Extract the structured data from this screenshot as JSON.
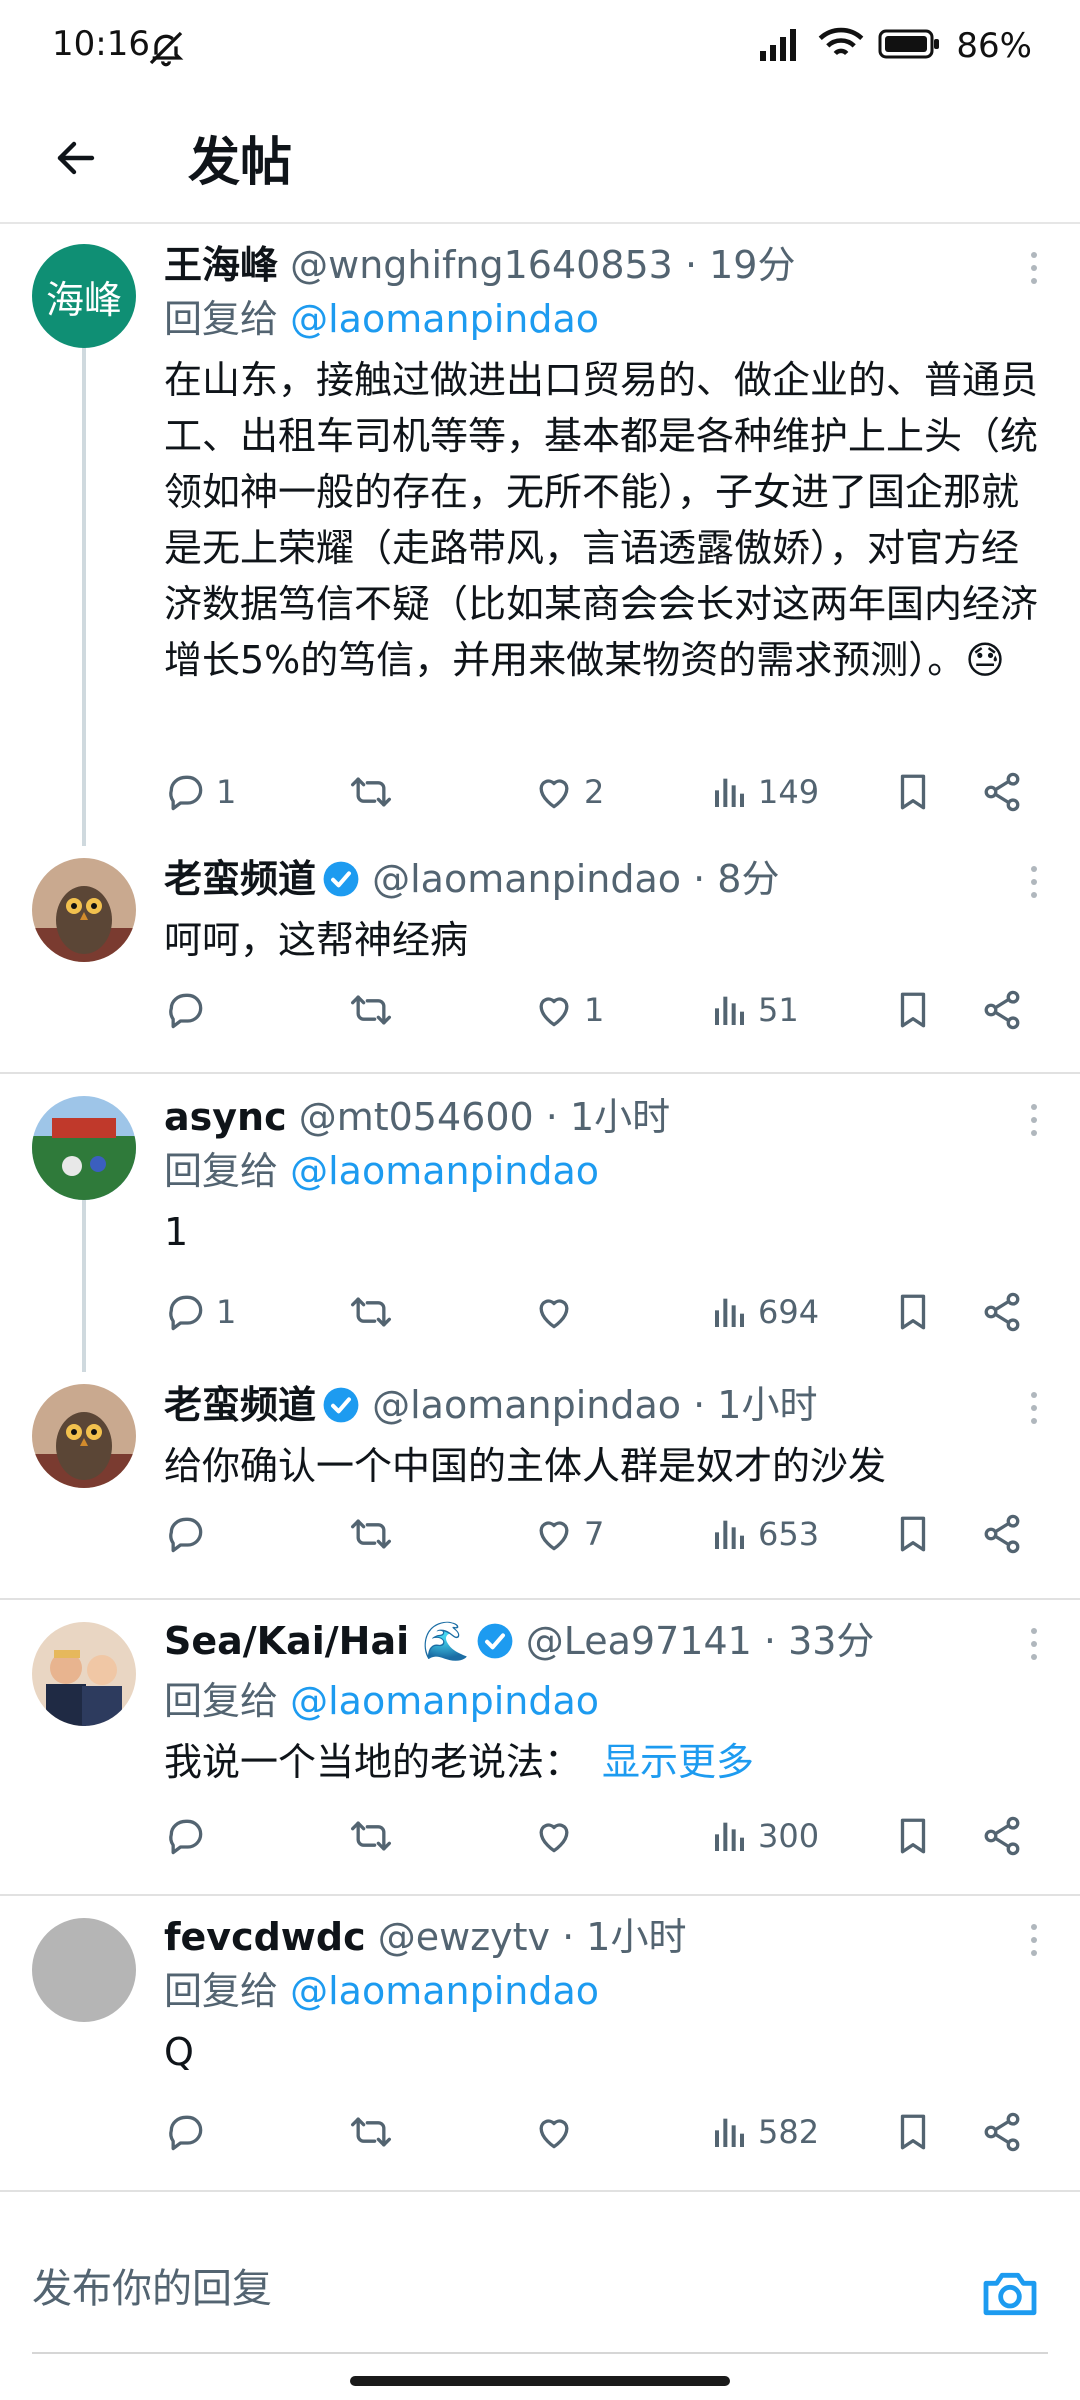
{
  "status": {
    "time": "10:16",
    "battery": "86%"
  },
  "header": {
    "title": "发帖"
  },
  "posts": [
    {
      "name": "王海峰",
      "handle": "@wnghifng1640853",
      "time": "· 19分",
      "reply_label": "回复给",
      "reply_to": "@laomanpindao",
      "avatar_text": "海峰",
      "text": "在山东，接触过做进出口贸易的、做企业的、普通员工、出租车司机等等，基本都是各种维护上上头（统领如神一般的存在，无所不能），子女进了国企那就是无上荣耀（走路带风，言语透露傲娇），对官方经济数据笃信不疑（比如某商会会长对这两年国内经济增长5%的笃信，并用来做某物资的需求预测）。😓",
      "replies": "1",
      "likes": "2",
      "views": "149"
    },
    {
      "name": "老蛮频道",
      "handle": "@laomanpindao",
      "time": "· 8分",
      "text": "呵呵，这帮神经病",
      "replies": "",
      "likes": "1",
      "views": "51"
    },
    {
      "name": "async",
      "handle": "@mt054600",
      "time": "· 1小时",
      "reply_label": "回复给",
      "reply_to": "@laomanpindao",
      "text": "1",
      "replies": "1",
      "likes": "",
      "views": "694"
    },
    {
      "name": "老蛮频道",
      "handle": "@laomanpindao",
      "time": "· 1小时",
      "text": "给你确认一个中国的主体人群是奴才的沙发",
      "replies": "",
      "likes": "7",
      "views": "653"
    },
    {
      "name": "Sea/Kai/Hai 🌊",
      "handle": "@Lea97141",
      "time": "· 33分",
      "reply_label": "回复给",
      "reply_to": "@laomanpindao",
      "text": "我说一个当地的老说法：",
      "more": "显示更多",
      "replies": "",
      "likes": "",
      "views": "300"
    },
    {
      "name": "fevcdwdc",
      "handle": "@ewzytv",
      "time": "· 1小时",
      "reply_label": "回复给",
      "reply_to": "@laomanpindao",
      "text": "Q",
      "replies": "",
      "likes": "",
      "views": "582"
    }
  ],
  "composer": {
    "placeholder": "发布你的回复"
  },
  "colors": {
    "accent": "#1d9bf0",
    "muted": "#536471",
    "divider": "#e1e1e1"
  },
  "icons": [
    "back-arrow-icon",
    "reply-icon",
    "retweet-icon",
    "like-icon",
    "views-icon",
    "bookmark-icon",
    "share-icon",
    "more-icon",
    "verified-icon",
    "camera-icon"
  ]
}
